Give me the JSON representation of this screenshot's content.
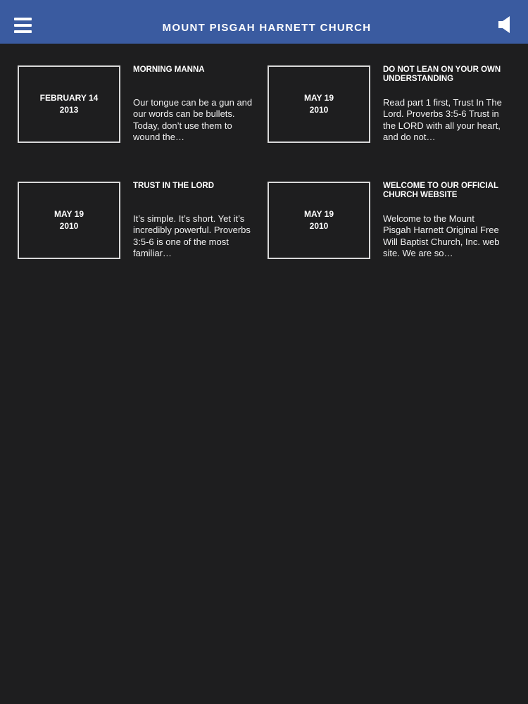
{
  "header": {
    "title": "MOUNT PISGAH HARNETT CHURCH",
    "menu_icon": "hamburger-menu-icon",
    "audio_icon": "speaker-icon",
    "bar_color": "#3a5ba0"
  },
  "theme": {
    "background": "#1e1e1f",
    "text": "#ffffff",
    "border": "#d9d9d9"
  },
  "posts": [
    {
      "date_line1": "FEBRUARY 14",
      "date_line2": "2013",
      "title": "MORNING MANNA",
      "excerpt": "Our tongue can be a gun and our words can be bullets.  Today, don’t use them to wound the…"
    },
    {
      "date_line1": "MAY 19",
      "date_line2": "2010",
      "title": "DO NOT LEAN ON YOUR OWN UNDERSTANDING",
      "excerpt": "Read part 1 first, Trust In The Lord. Proverbs 3:5-6 Trust in the LORD with all your heart, and do not…"
    },
    {
      "date_line1": "MAY 19",
      "date_line2": "2010",
      "title": "TRUST IN THE LORD",
      "excerpt": "It’s simple. It’s short. Yet it’s incredibly powerful. Proverbs 3:5-6 is one of the most familiar…"
    },
    {
      "date_line1": "MAY 19",
      "date_line2": "2010",
      "title": "WELCOME TO OUR OFFICIAL CHURCH WEBSITE",
      "excerpt": "Welcome to the Mount Pisgah Harnett Original Free Will Baptist Church, Inc. web site. We are so…"
    }
  ]
}
